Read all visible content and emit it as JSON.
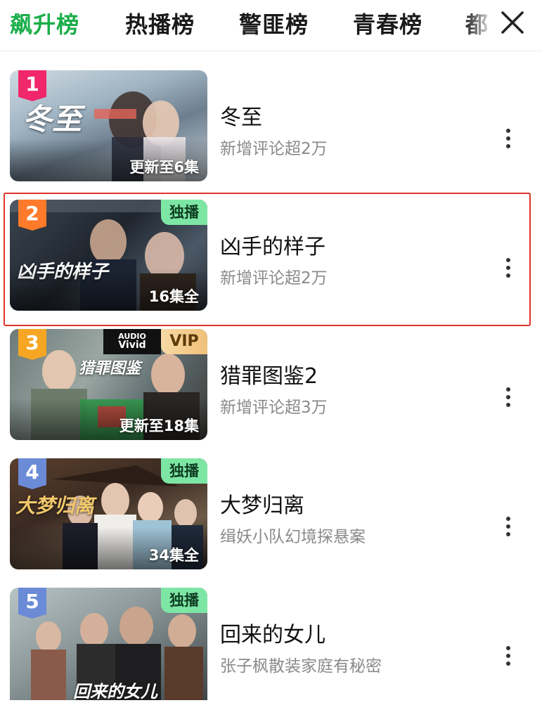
{
  "tabs": [
    {
      "label": "飙升榜",
      "active": true
    },
    {
      "label": "热播榜",
      "active": false
    },
    {
      "label": "警匪榜",
      "active": false
    },
    {
      "label": "青春榜",
      "active": false
    },
    {
      "label": "都",
      "active": false
    }
  ],
  "close_icon": "close-icon",
  "colors": {
    "accent": "#1aae4a",
    "highlight": "#e0322b"
  },
  "items": [
    {
      "rank": "1",
      "rank_color": "#f0276b",
      "title": "冬至",
      "subtitle": "新增评论超2万",
      "status": "更新至6集",
      "badge": "",
      "poster_logo": "冬至",
      "selected": false
    },
    {
      "rank": "2",
      "rank_color": "#ff7a2a",
      "title": "凶手的样子",
      "subtitle": "新增评论超2万",
      "status": "16集全",
      "badge": "独播",
      "poster_logo": "凶手的样子",
      "selected": true
    },
    {
      "rank": "3",
      "rank_color": "#f6a623",
      "title": "猎罪图鉴2",
      "subtitle": "新增评论超3万",
      "status": "更新至18集",
      "badge": "VIP",
      "audio_badge_top": "AUDIO",
      "audio_badge_bottom": "Vivid",
      "poster_logo": "猎罪图鉴",
      "selected": false
    },
    {
      "rank": "4",
      "rank_color": "#6b8bd6",
      "title": "大梦归离",
      "subtitle": "缉妖小队幻境探悬案",
      "status": "34集全",
      "badge": "独播",
      "poster_logo": "大梦归离",
      "selected": false
    },
    {
      "rank": "5",
      "rank_color": "#6b8bd6",
      "title": "回来的女儿",
      "subtitle": "张子枫散装家庭有秘密",
      "status": "",
      "badge": "独播",
      "poster_logo": "回来的女儿",
      "selected": false
    }
  ]
}
